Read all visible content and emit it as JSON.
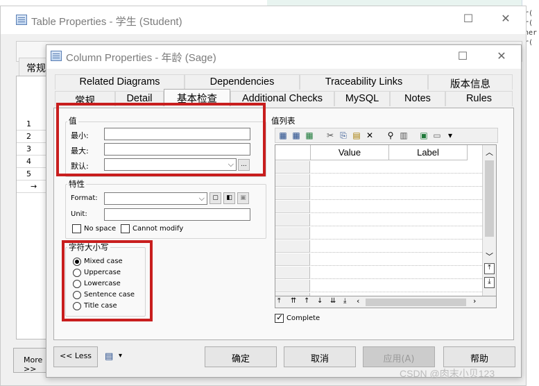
{
  "outer_window": {
    "title": "Table Properties - 学生 (Student)",
    "tab_label": "常规",
    "rows": [
      "1",
      "2",
      "3",
      "4",
      "5",
      "→"
    ],
    "more_button": "More >>"
  },
  "background": {
    "code_lines": [
      "r(",
      "r(",
      "ner",
      "r("
    ]
  },
  "dialog": {
    "title": "Column Properties - 年龄 (Sage)",
    "tabs_row1": [
      "Related Diagrams",
      "Dependencies",
      "Traceability Links",
      "版本信息"
    ],
    "tabs_row2": [
      "常规",
      "Detail",
      "基本检查",
      "Additional Checks",
      "MySQL",
      "Notes",
      "Rules"
    ],
    "active_tab": "基本检查",
    "values_group": {
      "label": "值",
      "min_label": "最小:",
      "max_label": "最大:",
      "default_label": "默认:",
      "min_value": "",
      "max_value": "",
      "default_value": "",
      "ellipsis": "..."
    },
    "props_group": {
      "label": "特性",
      "format_label": "Format:",
      "unit_label": "Unit:",
      "format_value": "",
      "unit_value": "",
      "no_space_label": "No space",
      "cannot_modify_label": "Cannot modify"
    },
    "case_group": {
      "label": "字符大小写",
      "options": [
        "Mixed case",
        "Uppercase",
        "Lowercase",
        "Sentence case",
        "Title case"
      ],
      "selected": "Mixed case"
    },
    "value_list": {
      "label": "值列表",
      "columns": [
        "Value",
        "Label"
      ],
      "complete_label": "Complete",
      "complete_checked": true
    },
    "footer": {
      "less_button": "<< Less",
      "ok": "确定",
      "cancel": "取消",
      "apply": "应用(A)",
      "help": "帮助"
    }
  },
  "watermark": "CSDN @肉末小贝123"
}
